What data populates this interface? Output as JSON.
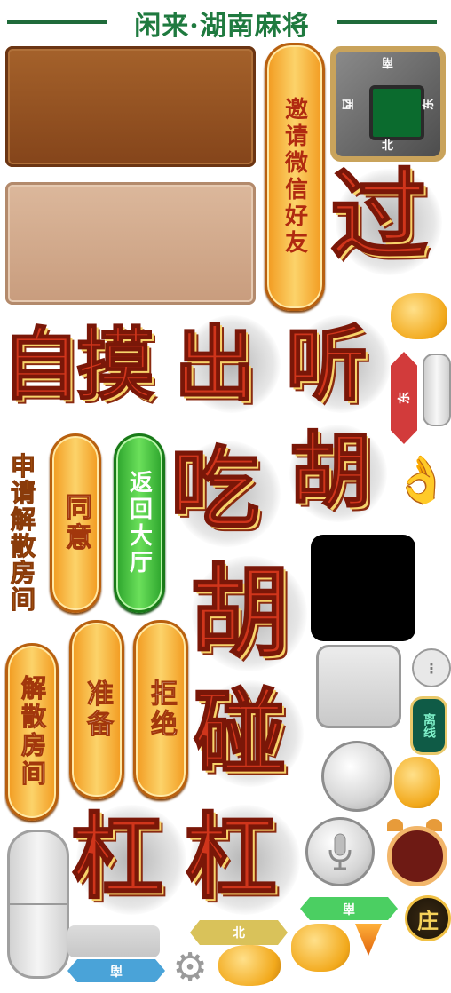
{
  "title": "闲来·湖南麻将",
  "buttons": {
    "invite_wechat": "邀请微信好友",
    "agree": "同意",
    "return_hall": "返回大厅",
    "ready": "准备",
    "refuse": "拒绝",
    "dissolve_room": "解散房间"
  },
  "labels": {
    "apply_dissolve": "申请解散房间"
  },
  "compass": {
    "north": "北",
    "south": "南",
    "east": "东",
    "west": "西"
  },
  "actions": {
    "pass": "过",
    "zimo": "自摸",
    "chu": "出",
    "ting": "听",
    "chi": "吃",
    "hu_small": "胡",
    "hu_big": "胡",
    "peng": "碰",
    "gang1": "杠",
    "gang2": "杠"
  },
  "badges": {
    "dealer": "庄",
    "offline": "离线"
  },
  "banners": {
    "east_vertical": "东",
    "south_green": "南",
    "north_gold": "北",
    "south_blue": "南"
  },
  "icons": [
    "chat-bubble-icon",
    "ok-hand-icon",
    "chat-dots-icon",
    "microphone-icon",
    "alarm-clock-icon",
    "gear-icon",
    "droplet-icon"
  ],
  "colors": {
    "title_green": "#1f7a3f",
    "orange_button": "#f5a623",
    "green_button": "#3cbf3c",
    "calligraphy_red": "#d0351b"
  }
}
